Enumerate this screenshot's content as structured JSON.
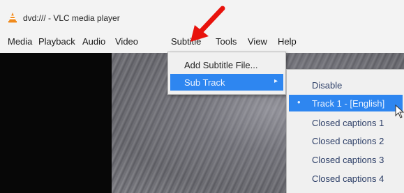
{
  "window": {
    "title": "dvd:/// - VLC media player"
  },
  "menubar": {
    "items": [
      "Media",
      "Playback",
      "Audio",
      "Video",
      "Subtitle",
      "Tools",
      "View",
      "Help"
    ]
  },
  "subtitle_menu": {
    "items": [
      {
        "label": "Add Subtitle File..."
      },
      {
        "label": "Sub Track",
        "arrow": "▸"
      }
    ]
  },
  "subtrack_menu": {
    "items": [
      {
        "label": "Disable"
      },
      {
        "label": "Track 1 - [English]",
        "bullet": "•"
      },
      {
        "label": "Closed captions 1"
      },
      {
        "label": "Closed captions 2"
      },
      {
        "label": "Closed captions 3"
      },
      {
        "label": "Closed captions 4"
      }
    ]
  },
  "colors": {
    "highlight": "#2e86f0",
    "annotation_arrow": "#e8120c",
    "vlc_orange": "#f08a1c"
  },
  "icons": {
    "app": "vlc-cone-icon",
    "submenu_arrow": "chevron-right-icon",
    "pointer": "mouse-cursor-icon",
    "annotation": "red-arrow-annotation"
  }
}
